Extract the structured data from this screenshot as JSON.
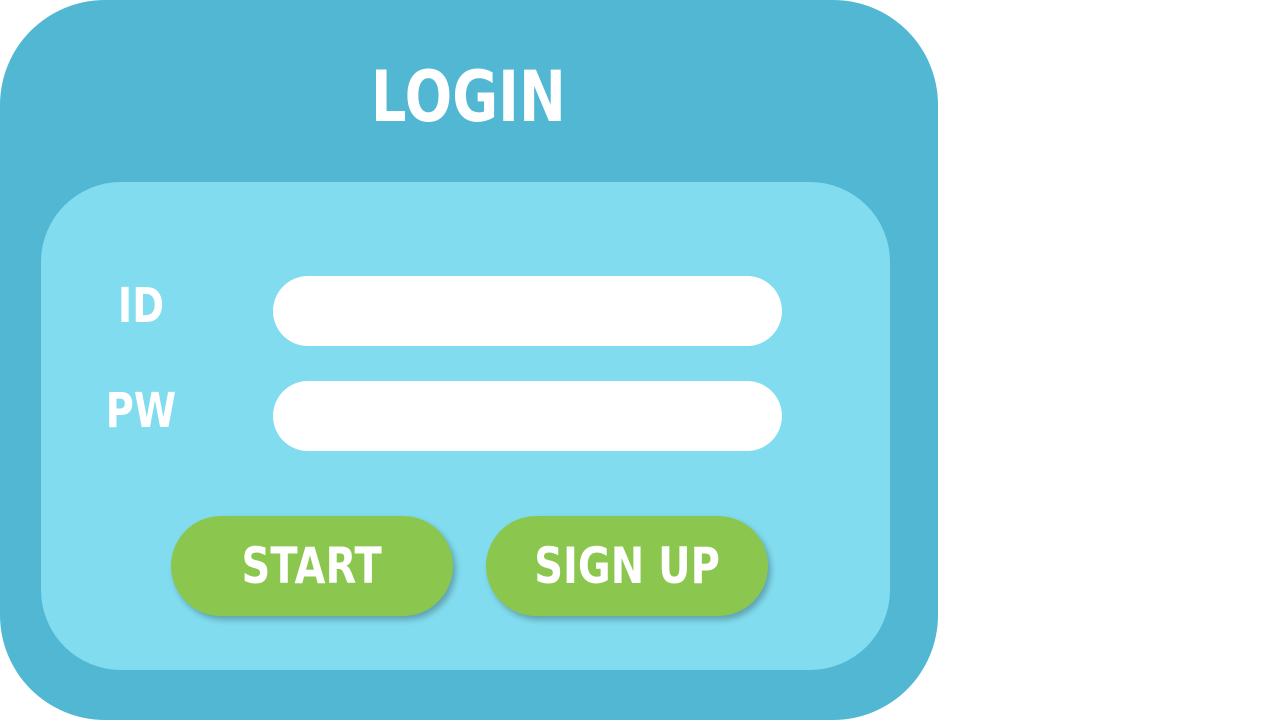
{
  "window": {
    "title": "LOGIN"
  },
  "form": {
    "id_label": "ID",
    "id_value": "",
    "pw_label": "PW",
    "pw_value": ""
  },
  "buttons": {
    "start_label": "START",
    "signup_label": "SIGN UP"
  },
  "colors": {
    "outer_panel": "#52b7d2",
    "inner_panel": "#80dcee",
    "button": "#8bc74e",
    "text": "#ffffff",
    "input_background": "#ffffff"
  }
}
